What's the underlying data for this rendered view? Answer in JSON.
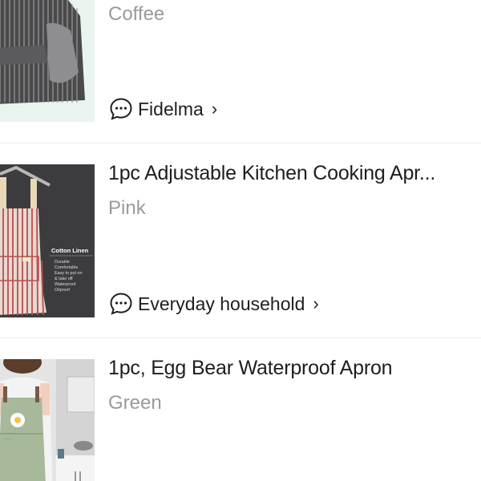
{
  "items": [
    {
      "variant": "Coffee",
      "shop": "Fidelma",
      "image_icon": "striped-apron-image"
    },
    {
      "title": "1pc Adjustable Kitchen Cooking Apr...",
      "variant": "Pink",
      "shop": "Everyday household",
      "image_icon": "pink-striped-apron-image",
      "image_text": {
        "heading": "Cotton Linen",
        "lines": [
          "Durable",
          "Comfortable",
          "Easy to put on",
          "& take off",
          "Waterproof",
          "Oilproof"
        ]
      }
    },
    {
      "title": "1pc, Egg Bear Waterproof Apron",
      "variant": "Green",
      "image_icon": "green-egg-apron-image"
    }
  ],
  "icons": {
    "shop_chat": "chat-bubble-icon",
    "chevron": "chevron-right-icon"
  },
  "colors": {
    "title": "#1e1e1e",
    "variant": "#9a9a9a",
    "divider": "#ececec"
  }
}
